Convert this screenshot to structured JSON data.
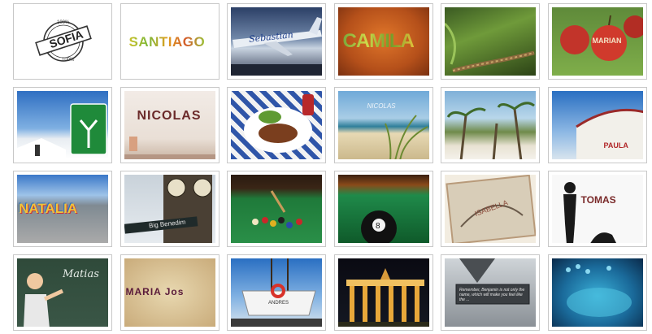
{
  "gallery": {
    "row1": [
      "SOFIA",
      "SANTIAGO",
      "Sebastian",
      "CAMILA",
      "",
      "MARIAN"
    ],
    "row2": [
      "",
      "NICOLAS",
      "",
      "NICOLAS",
      "",
      "PAULA"
    ],
    "row3": [
      "NATALIA",
      "Big Benedim",
      "",
      "",
      "ISABELLA",
      "TOMAS"
    ],
    "row4": [
      "Matias",
      "MARIA Jos",
      "ANDRES",
      "",
      "",
      ""
    ],
    "sofia_stamp_top": "100%",
    "sofia_stamp_bottom": "100%",
    "plate_caption": "Remember, Benjamin is not only the name, which will make you feel like the ..."
  }
}
